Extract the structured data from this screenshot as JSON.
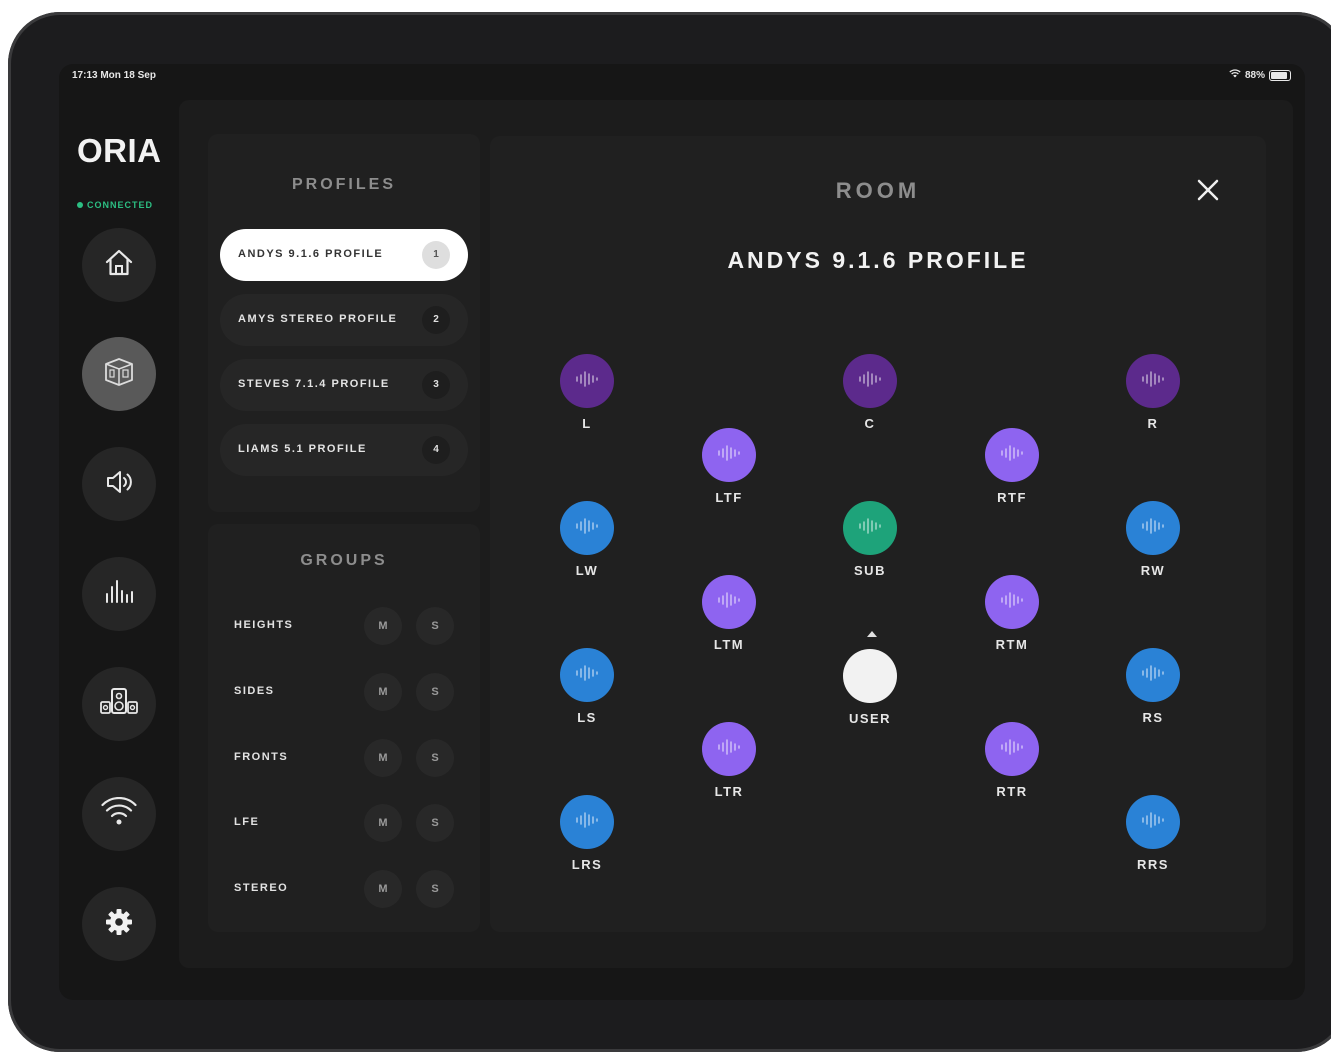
{
  "status_bar": {
    "time": "17:13  Mon 18 Sep",
    "battery": "88%",
    "wifi_icon": "wifi-icon",
    "battery_icon": "battery-icon"
  },
  "brand": {
    "logo": "ORIA",
    "connection_status": "CONNECTED",
    "status_color": "#2cbf83"
  },
  "nav": {
    "items": [
      {
        "id": "home",
        "icon": "home-icon",
        "active": false
      },
      {
        "id": "room",
        "icon": "room-cube-icon",
        "active": true
      },
      {
        "id": "volume",
        "icon": "speaker-volume-icon",
        "active": false
      },
      {
        "id": "eq",
        "icon": "equalizer-bars-icon",
        "active": false
      },
      {
        "id": "speakers",
        "icon": "speakers-icon",
        "active": false
      },
      {
        "id": "wifi",
        "icon": "wifi-icon",
        "active": false
      },
      {
        "id": "settings",
        "icon": "gear-icon",
        "active": false
      }
    ]
  },
  "profiles": {
    "title": "PROFILES",
    "items": [
      {
        "name": "ANDYS 9.1.6 PROFILE",
        "number": "1",
        "active": true
      },
      {
        "name": "AMYS STEREO PROFILE",
        "number": "2",
        "active": false
      },
      {
        "name": "STEVES 7.1.4 PROFILE",
        "number": "3",
        "active": false
      },
      {
        "name": "LIAMS 5.1 PROFILE",
        "number": "4",
        "active": false
      }
    ]
  },
  "groups": {
    "title": "GROUPS",
    "mute_label": "M",
    "solo_label": "S",
    "items": [
      {
        "name": "HEIGHTS"
      },
      {
        "name": "SIDES"
      },
      {
        "name": "FRONTS"
      },
      {
        "name": "LFE"
      },
      {
        "name": "STEREO"
      }
    ]
  },
  "room": {
    "title": "ROOM",
    "profile_name": "ANDYS 9.1.6 PROFILE",
    "close_icon": "close-icon",
    "colors": {
      "front": "#5c2a8c",
      "height": "#8e64f0",
      "side": "#2a82d6",
      "sub": "#1ea37a",
      "user": "#f2f2f2"
    },
    "speakers": [
      {
        "id": "L",
        "label": "L",
        "type": "front"
      },
      {
        "id": "C",
        "label": "C",
        "type": "front"
      },
      {
        "id": "R",
        "label": "R",
        "type": "front"
      },
      {
        "id": "LTF",
        "label": "LTF",
        "type": "height"
      },
      {
        "id": "RTF",
        "label": "RTF",
        "type": "height"
      },
      {
        "id": "LW",
        "label": "LW",
        "type": "side"
      },
      {
        "id": "SUB",
        "label": "SUB",
        "type": "sub"
      },
      {
        "id": "RW",
        "label": "RW",
        "type": "side"
      },
      {
        "id": "LTM",
        "label": "LTM",
        "type": "height"
      },
      {
        "id": "RTM",
        "label": "RTM",
        "type": "height"
      },
      {
        "id": "LS",
        "label": "LS",
        "type": "side"
      },
      {
        "id": "USER",
        "label": "USER",
        "type": "user"
      },
      {
        "id": "RS",
        "label": "RS",
        "type": "side"
      },
      {
        "id": "LTR",
        "label": "LTR",
        "type": "height"
      },
      {
        "id": "RTR",
        "label": "RTR",
        "type": "height"
      },
      {
        "id": "LRS",
        "label": "LRS",
        "type": "side"
      },
      {
        "id": "RRS",
        "label": "RRS",
        "type": "side"
      }
    ]
  }
}
